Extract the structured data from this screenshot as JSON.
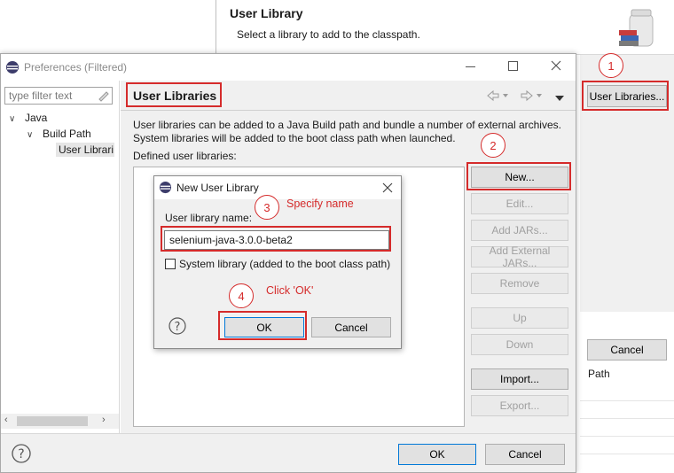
{
  "background_dialog": {
    "title": "User Library",
    "subtitle": "Select a library to add to the classpath.",
    "user_libraries_button": "User Libraries...",
    "cancel_button": "Cancel",
    "path_text": "Path"
  },
  "preferences": {
    "window_title": "Preferences (Filtered)",
    "filter_placeholder": "type filter text",
    "tree": [
      "Java",
      "Build Path",
      "User Librari"
    ],
    "page_title": "User Libraries",
    "description_line1": "User libraries can be added to a Java Build path and bundle a number of external archives.",
    "description_line2": "System libraries will be added to the boot class path when launched.",
    "defined_label": "Defined user libraries:",
    "buttons": {
      "new": "New...",
      "edit": "Edit...",
      "add_jars": "Add JARs...",
      "add_external_jars": "Add External JARs...",
      "remove": "Remove",
      "up": "Up",
      "down": "Down",
      "import": "Import...",
      "export": "Export..."
    },
    "ok_button": "OK",
    "cancel_button": "Cancel"
  },
  "new_user_library_dialog": {
    "title": "New User Library",
    "name_label": "User library name:",
    "name_value": "selenium-java-3.0.0-beta2",
    "system_library_label": "System library (added to the boot class path)",
    "system_library_checked": false,
    "ok_button": "OK",
    "cancel_button": "Cancel"
  },
  "annotations": {
    "steps": [
      "1",
      "2",
      "3",
      "4"
    ],
    "specify_name": "Specify name",
    "click_ok": "Click 'OK'"
  },
  "colors": {
    "annotation_red": "#d52b2b",
    "selection_blue": "#cce8ff",
    "accent_blue": "#0078d7"
  },
  "icons": [
    "eclipse-icon",
    "library-jar-icon",
    "help-icon",
    "minimize-icon",
    "maximize-icon",
    "close-icon",
    "back-arrow-icon",
    "forward-arrow-icon",
    "view-menu-icon",
    "clear-filter-icon",
    "chevron-right-icon",
    "chevron-down-icon",
    "chevron-left-icon"
  ]
}
